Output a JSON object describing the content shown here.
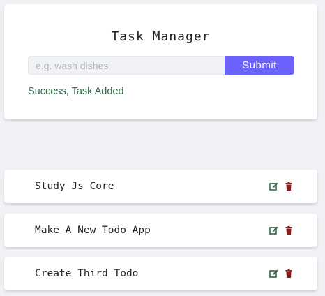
{
  "header": {
    "title": "Task Manager"
  },
  "form": {
    "input_value": "",
    "placeholder": "e.g. wash dishes",
    "submit_label": "Submit"
  },
  "alert": {
    "text": "Success, Task Added",
    "color": "#2f6b4a"
  },
  "tasks": [
    {
      "text": "Study Js Core",
      "edit_icon": "edit-icon",
      "delete_icon": "trash-icon"
    },
    {
      "text": "Make A New Todo App",
      "edit_icon": "edit-icon",
      "delete_icon": "trash-icon"
    },
    {
      "text": "Create Third Todo",
      "edit_icon": "edit-icon",
      "delete_icon": "trash-icon"
    }
  ],
  "colors": {
    "background": "#f1f2f6",
    "accent": "#6c63ff",
    "edit": "#2f6b4a",
    "delete": "#8b1a1a"
  }
}
